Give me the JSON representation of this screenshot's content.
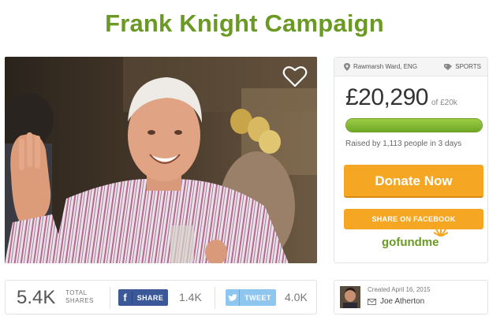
{
  "page": {
    "title": "Frank Knight Campaign"
  },
  "campaign": {
    "location": "Rawmarsh Ward, ENG",
    "category": "SPORTS",
    "raised_amount": "£20,290",
    "goal_text": "of £20k",
    "progress_fraction": 1.0,
    "raised_by": "Raised by 1,113 people in 3 days",
    "donate_label": "Donate Now",
    "facebook_share_label": "SHARE ON FACEBOOK",
    "logo_text": "gofundme"
  },
  "share_bar": {
    "total_count": "5.4K",
    "total_label_line1": "TOTAL",
    "total_label_line2": "SHARES",
    "facebook_label": "SHARE",
    "facebook_count": "1.4K",
    "twitter_label": "TWEET",
    "twitter_count": "4.0K"
  },
  "organizer": {
    "created": "Created April 16, 2015",
    "name": "Joe Atherton"
  },
  "icons": {
    "heart": "heart-outline-icon",
    "location": "map-pin-icon",
    "tag": "tag-icon",
    "facebook": "facebook-icon",
    "twitter": "twitter-icon",
    "mail": "mail-icon"
  },
  "colors": {
    "brand_green": "#6b9a24",
    "donate_orange": "#f5a623",
    "facebook_blue": "#3b5998",
    "twitter_blue": "#8fc6ef"
  }
}
